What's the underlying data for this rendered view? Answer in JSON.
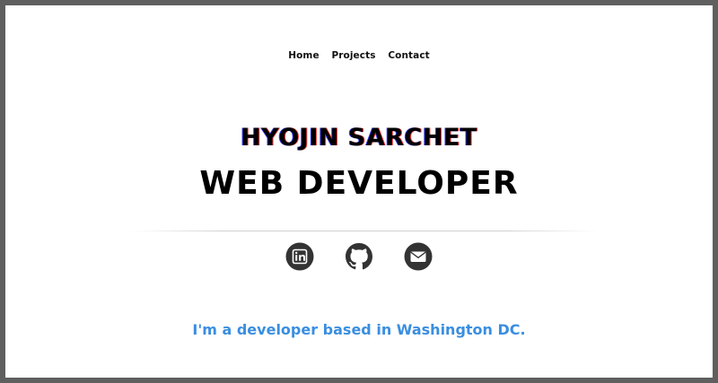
{
  "nav": {
    "items": [
      {
        "label": "Home"
      },
      {
        "label": "Projects"
      },
      {
        "label": "Contact"
      }
    ]
  },
  "hero": {
    "name": "HYOJIN SARCHET",
    "role": "WEB DEVELOPER"
  },
  "social": {
    "icons": [
      "linkedin-icon",
      "github-icon",
      "email-icon"
    ]
  },
  "tagline": "I'm a developer based in Washington DC.",
  "colors": {
    "frame": "#5f5f5f",
    "accent": "#3a8ee0",
    "icon": "#333333",
    "text": "#000000"
  }
}
